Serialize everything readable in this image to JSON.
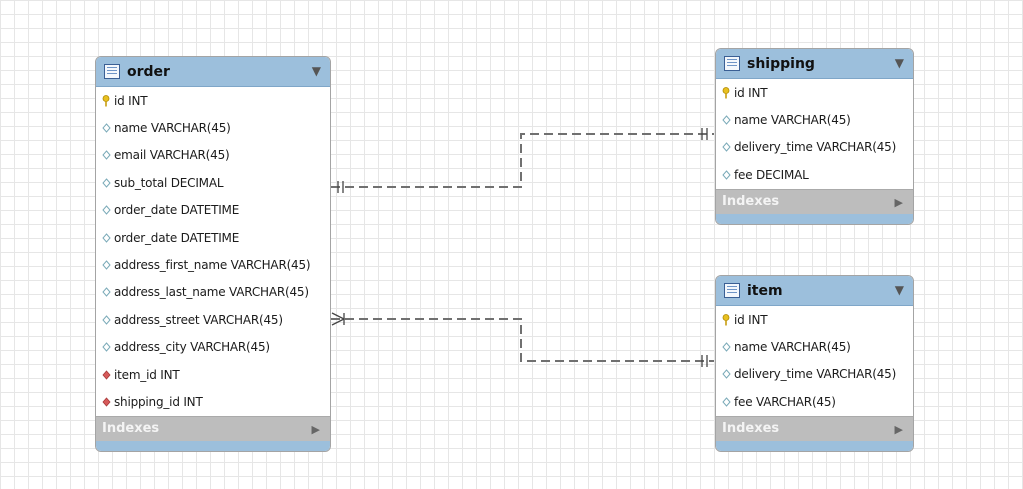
{
  "tables": {
    "order": {
      "title": "order",
      "columns": [
        {
          "kind": "pk",
          "label": "id INT"
        },
        {
          "kind": "col",
          "label": "name VARCHAR(45)"
        },
        {
          "kind": "col",
          "label": "email VARCHAR(45)"
        },
        {
          "kind": "col",
          "label": "sub_total DECIMAL"
        },
        {
          "kind": "col",
          "label": "order_date DATETIME"
        },
        {
          "kind": "col",
          "label": "order_date DATETIME"
        },
        {
          "kind": "col",
          "label": "address_first_name VARCHAR(45)"
        },
        {
          "kind": "col",
          "label": "address_last_name VARCHAR(45)"
        },
        {
          "kind": "col",
          "label": "address_street VARCHAR(45)"
        },
        {
          "kind": "col",
          "label": "address_city VARCHAR(45)"
        },
        {
          "kind": "fk",
          "label": "item_id INT"
        },
        {
          "kind": "fk",
          "label": "shipping_id INT"
        }
      ],
      "indexes_label": "Indexes"
    },
    "shipping": {
      "title": "shipping",
      "columns": [
        {
          "kind": "pk",
          "label": "id INT"
        },
        {
          "kind": "col",
          "label": "name VARCHAR(45)"
        },
        {
          "kind": "col",
          "label": "delivery_time VARCHAR(45)"
        },
        {
          "kind": "col",
          "label": "fee DECIMAL"
        }
      ],
      "indexes_label": "Indexes"
    },
    "item": {
      "title": "item",
      "columns": [
        {
          "kind": "pk",
          "label": "id INT"
        },
        {
          "kind": "col",
          "label": "name VARCHAR(45)"
        },
        {
          "kind": "col",
          "label": "delivery_time VARCHAR(45)"
        },
        {
          "kind": "col",
          "label": "fee VARCHAR(45)"
        }
      ],
      "indexes_label": "Indexes"
    }
  },
  "colors": {
    "header": "#9cbfdc",
    "indexes_bar": "#bdbdbd",
    "connector": "#707070",
    "primary_key": "#e8c020",
    "foreign_key": "#d65a5a",
    "column": "#7aaab8"
  },
  "icons": {
    "table": "table-grid-icon",
    "primary_key": "key-icon",
    "foreign_key": "red-diamond-icon",
    "column": "diamond-outline-icon",
    "collapse": "triangle-down-icon",
    "expand_indexes": "triangle-right-icon"
  }
}
